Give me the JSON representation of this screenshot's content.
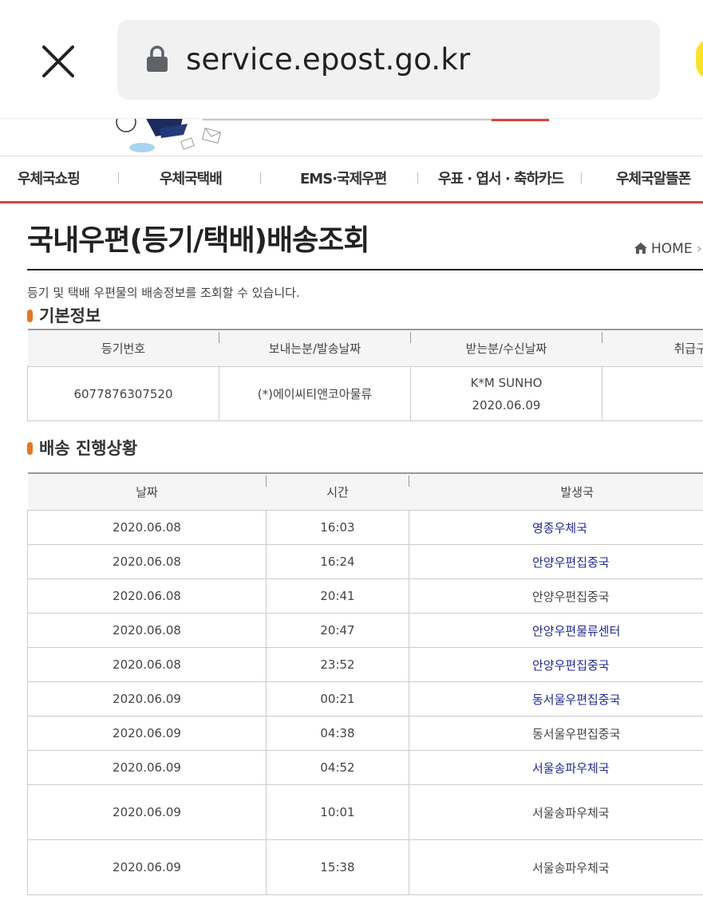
{
  "browser": {
    "url": "service.epost.go.kr"
  },
  "nav": {
    "items": [
      "우체국쇼핑",
      "우체국택배",
      "EMS·국제우편",
      "우표 · 엽서 · 축하카드",
      "우체국알뜰폰"
    ]
  },
  "page": {
    "title": "국내우편(등기/택배)배송조회",
    "home": "HOME",
    "description": "등기 및 택배 우편물의 배송정보를 조회할 수 있습니다."
  },
  "basic_info": {
    "heading": "기본정보",
    "headers": [
      "등기번호",
      "보내는분/발송날짜",
      "받는분/수신날짜",
      "취급구"
    ],
    "row": {
      "tracking_no": "6077876307520",
      "sender": "(*)에이씨티앤코아물류",
      "receiver": "K*M SUNHO",
      "received_date": "2020.06.09",
      "handling": ""
    }
  },
  "tracking": {
    "heading": "배송 진행상황",
    "headers": [
      "날짜",
      "시간",
      "발생국"
    ],
    "rows": [
      {
        "date": "2020.06.08",
        "time": "16:03",
        "office": "영종우체국",
        "link": true
      },
      {
        "date": "2020.06.08",
        "time": "16:24",
        "office": "안양우편집중국",
        "link": true
      },
      {
        "date": "2020.06.08",
        "time": "20:41",
        "office": "안양우편집중국",
        "link": false
      },
      {
        "date": "2020.06.08",
        "time": "20:47",
        "office": "안양우편물류센터",
        "link": true
      },
      {
        "date": "2020.06.08",
        "time": "23:52",
        "office": "안양우편집중국",
        "link": true
      },
      {
        "date": "2020.06.09",
        "time": "00:21",
        "office": "동서울우편집중국",
        "link": true
      },
      {
        "date": "2020.06.09",
        "time": "04:38",
        "office": "동서울우편집중국",
        "link": false
      },
      {
        "date": "2020.06.09",
        "time": "04:52",
        "office": "서울송파우체국",
        "link": true
      },
      {
        "date": "2020.06.09",
        "time": "10:01",
        "office": "서울송파우체국",
        "link": false
      },
      {
        "date": "2020.06.09",
        "time": "15:38",
        "office": "서울송파우체국",
        "link": false
      }
    ]
  },
  "colors": {
    "accent_red": "#d9433d",
    "link_blue": "#1f2b8f",
    "bullet_orange": "#e87722"
  }
}
